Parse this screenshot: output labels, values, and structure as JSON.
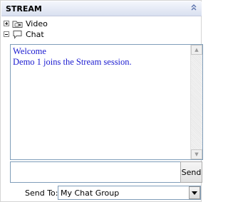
{
  "header": {
    "title": "STREAM",
    "collapse_icon": "double-chevron-up-icon"
  },
  "tree": [
    {
      "label": "Video",
      "expander": "plus",
      "icon": "video-folder-icon"
    },
    {
      "label": "Chat",
      "expander": "minus",
      "icon": "chat-bubble-icon"
    }
  ],
  "chat": {
    "messages": [
      "Welcome",
      "Demo 1 joins the Stream session."
    ],
    "text_color": "#1a1ad0"
  },
  "composer": {
    "input_value": "",
    "send_label": "Send"
  },
  "send_to": {
    "label": "Send To:",
    "selected": "My Chat Group"
  }
}
